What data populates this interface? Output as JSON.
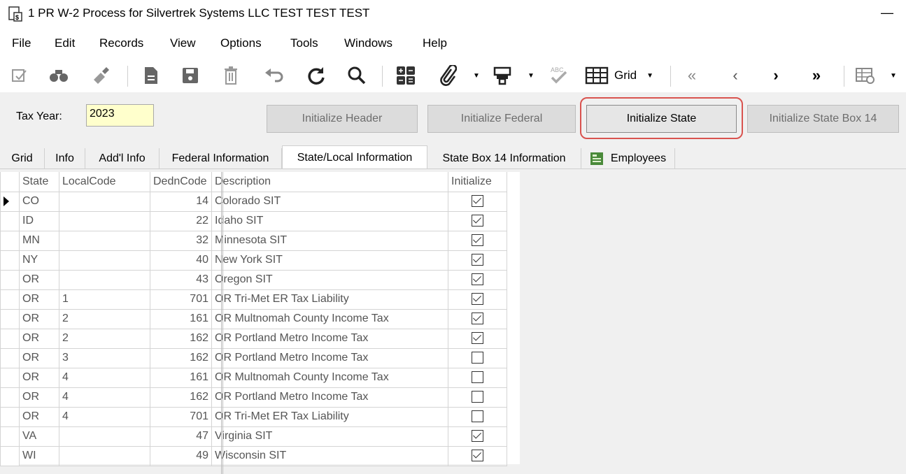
{
  "window": {
    "title": "1 PR W-2 Process for Silvertrek Systems LLC TEST TEST TEST",
    "minimize_glyph": "—"
  },
  "menu": [
    "File",
    "Edit",
    "Records",
    "View",
    "Options",
    "Tools",
    "Windows",
    "Help"
  ],
  "toolbar": {
    "grid_label": "Grid",
    "icons": [
      "edit-icon",
      "find-icon",
      "clear-icon",
      "new-icon",
      "save-icon",
      "delete-icon",
      "undo-icon",
      "refresh-icon",
      "search-icon",
      "calculator-icon",
      "attachment-icon",
      "print-icon",
      "spellcheck-icon",
      "grid-icon",
      "first-record-icon",
      "previous-record-icon",
      "next-record-icon",
      "last-record-icon",
      "grid-settings-icon"
    ]
  },
  "header": {
    "tax_year_label": "Tax Year:",
    "tax_year_value": "2023",
    "buttons": {
      "initialize_header": "Initialize Header",
      "initialize_federal": "Initialize Federal",
      "initialize_state": "Initialize State",
      "initialize_state_box14": "Initialize State Box 14"
    },
    "highlight_color": "#d9534f",
    "input_bg": "#ffffcc"
  },
  "tabs": [
    "Grid",
    "Info",
    "Add'l Info",
    "Federal Information",
    "State/Local Information",
    "State Box 14 Information",
    "Employees"
  ],
  "active_tab": "State/Local Information",
  "grid": {
    "columns": {
      "state": "State",
      "local": "LocalCode",
      "dedn": "DednCode",
      "desc": "Description",
      "init": "Initialize"
    },
    "rows": [
      {
        "state": "CO",
        "local": "",
        "dedn": "14",
        "desc": "Colorado SIT",
        "init": true
      },
      {
        "state": "ID",
        "local": "",
        "dedn": "22",
        "desc": "Idaho SIT",
        "init": true
      },
      {
        "state": "MN",
        "local": "",
        "dedn": "32",
        "desc": "Minnesota SIT",
        "init": true
      },
      {
        "state": "NY",
        "local": "",
        "dedn": "40",
        "desc": "New York SIT",
        "init": true
      },
      {
        "state": "OR",
        "local": "",
        "dedn": "43",
        "desc": "Oregon SIT",
        "init": true
      },
      {
        "state": "OR",
        "local": "1",
        "dedn": "701",
        "desc": "OR Tri-Met ER Tax Liability",
        "init": true
      },
      {
        "state": "OR",
        "local": "2",
        "dedn": "161",
        "desc": "OR Multnomah County Income Tax",
        "init": true
      },
      {
        "state": "OR",
        "local": "2",
        "dedn": "162",
        "desc": "OR Portland Metro Income Tax",
        "init": true
      },
      {
        "state": "OR",
        "local": "3",
        "dedn": "162",
        "desc": "OR Portland Metro Income Tax",
        "init": false
      },
      {
        "state": "OR",
        "local": "4",
        "dedn": "161",
        "desc": "OR Multnomah County Income Tax",
        "init": false
      },
      {
        "state": "OR",
        "local": "4",
        "dedn": "162",
        "desc": "OR Portland Metro Income Tax",
        "init": false
      },
      {
        "state": "OR",
        "local": "4",
        "dedn": "701",
        "desc": "OR Tri-Met ER Tax Liability",
        "init": false
      },
      {
        "state": "VA",
        "local": "",
        "dedn": "47",
        "desc": "Virginia SIT",
        "init": true
      },
      {
        "state": "WI",
        "local": "",
        "dedn": "49",
        "desc": "Wisconsin SIT",
        "init": true
      }
    ]
  }
}
